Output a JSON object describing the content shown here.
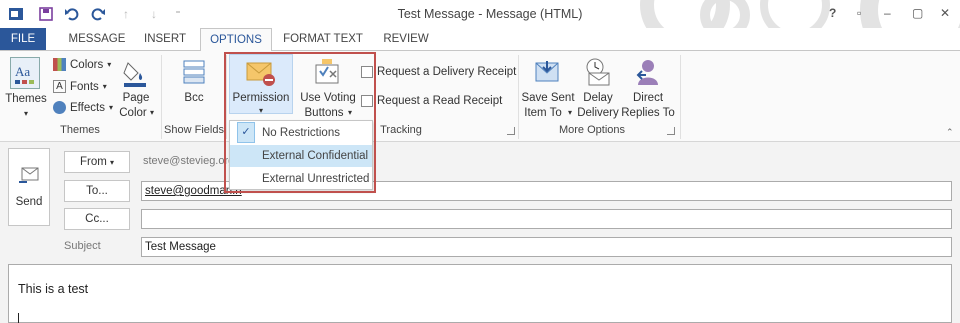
{
  "window": {
    "title": "Test Message - Message (HTML)",
    "controls": [
      "?",
      "▫",
      "–",
      "▢",
      "✕"
    ]
  },
  "tabs": [
    "FILE",
    "MESSAGE",
    "INSERT",
    "OPTIONS",
    "FORMAT TEXT",
    "REVIEW"
  ],
  "active_tab": "OPTIONS",
  "ribbon": {
    "themes_group": {
      "label": "Themes",
      "themes_button": "Themes",
      "colors": "Colors",
      "fonts": "Fonts",
      "effects": "Effects",
      "page_color_line1": "Page",
      "page_color_line2": "Color"
    },
    "show_fields_group": {
      "label": "Show Fields",
      "bcc": "Bcc"
    },
    "permission_button": "Permission",
    "tracking_group": {
      "label": "Tracking",
      "voting_line1": "Use Voting",
      "voting_line2": "Buttons",
      "delivery_receipt": "Request a Delivery Receipt",
      "read_receipt": "Request a Read Receipt"
    },
    "more_options_group": {
      "label": "More Options",
      "save_sent_line1": "Save Sent",
      "save_sent_line2": "Item To",
      "delay_line1": "Delay",
      "delay_line2": "Delivery",
      "direct_line1": "Direct",
      "direct_line2": "Replies To"
    }
  },
  "permission_menu": {
    "items": [
      "No Restrictions",
      "External Confidential",
      "External Unrestricted"
    ],
    "checked": "No Restrictions",
    "hovered": "External Confidential"
  },
  "compose": {
    "send": "Send",
    "from_button": "From",
    "from_value": "steve@stevieg.org",
    "to_button": "To...",
    "to_value": "steve@goodman.n",
    "cc_button": "Cc...",
    "cc_value": "",
    "subject_label": "Subject",
    "subject_value": "Test Message",
    "body": "This is a test"
  },
  "colors": {
    "accent": "#2b579a",
    "highlight_border": "#c0504d",
    "menu_hover": "#cde6f7"
  }
}
